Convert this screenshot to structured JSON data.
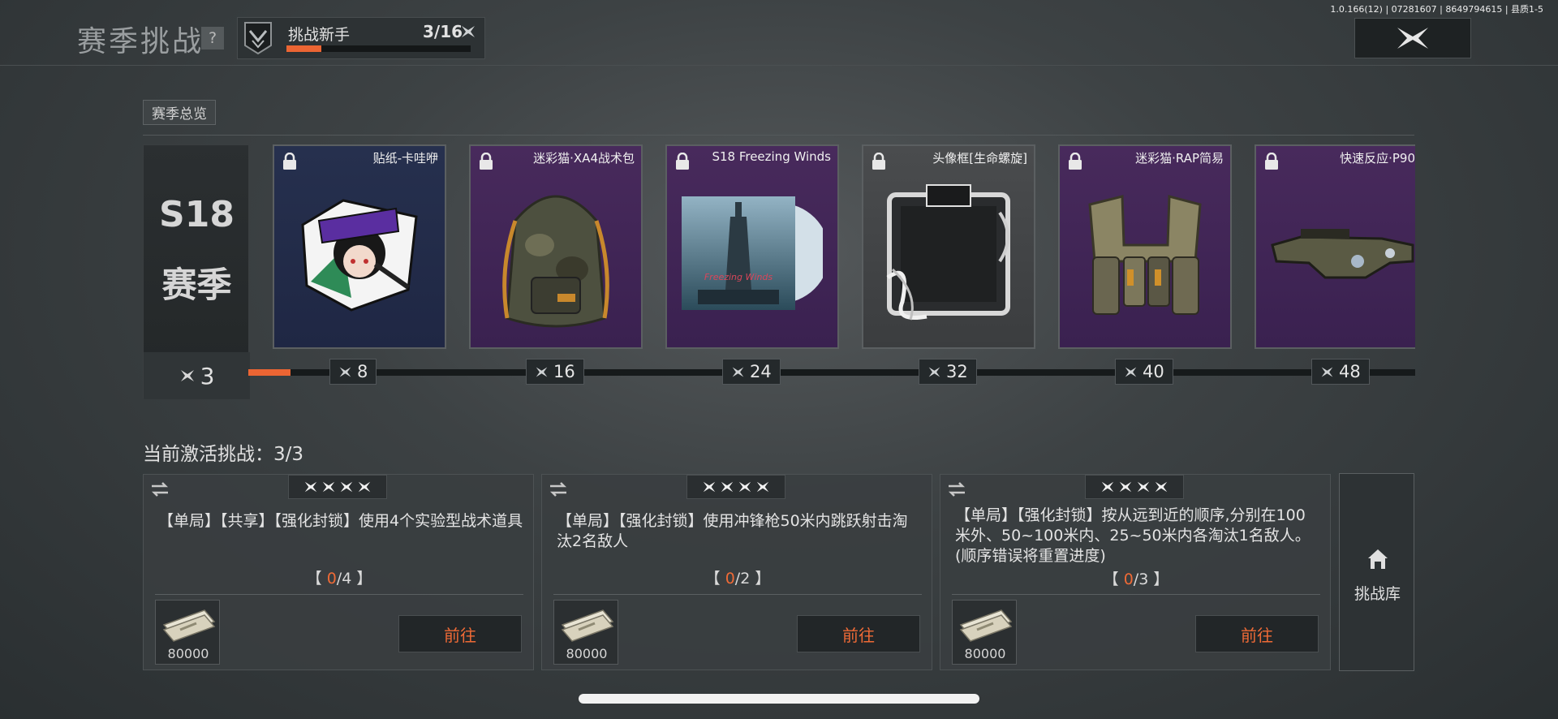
{
  "header": {
    "title": "赛季挑战",
    "help_label": "?",
    "rank_name": "挑战新手",
    "rank_progress_text": "3/16",
    "rank_progress_fraction": 0.1875,
    "version": "1.0.166(12) | 07281607 | 8649794615 | 县质1-5"
  },
  "overview": {
    "tag": "赛季总览",
    "season_line1": "S18",
    "season_line2": "赛季",
    "current_stars": "3",
    "track_fill_fraction": 0.02,
    "accent_color": "#ec6533",
    "rewards": [
      {
        "name": "贴纸-卡哇咿",
        "cost": "8",
        "rarity": "blue",
        "icon": "sticker-icon"
      },
      {
        "name": "迷彩猫·XA4战术包",
        "cost": "16",
        "rarity": "purple",
        "icon": "backpack-icon"
      },
      {
        "name": "S18 Freezing Winds",
        "cost": "24",
        "rarity": "purple",
        "icon": "album-icon"
      },
      {
        "name": "头像框[生命螺旋]",
        "cost": "32",
        "rarity": "gray",
        "icon": "avatar-frame-icon"
      },
      {
        "name": "迷彩猫·RAP简易",
        "cost": "40",
        "rarity": "purple",
        "icon": "vest-icon"
      },
      {
        "name": "快速反应·P90",
        "cost": "48",
        "rarity": "purple",
        "icon": "smg-icon"
      }
    ]
  },
  "challenges": {
    "header": "当前激活挑战：3/3",
    "items": [
      {
        "desc": "【单局】【共享】【强化封锁】使用4个实验型战术道具",
        "prog_open": "【 ",
        "done": "0",
        "total": "/4",
        "prog_close": " 】",
        "reward": "80000",
        "go": "前往"
      },
      {
        "desc": "【单局】【强化封锁】使用冲锋枪50米内跳跃射击淘汰2名敌人",
        "prog_open": "【 ",
        "done": "0",
        "total": "/2",
        "prog_close": " 】",
        "reward": "80000",
        "go": "前往"
      },
      {
        "desc": "【单局】【强化封锁】按从远到近的顺序,分别在100米外、50~100米内、25~50米内各淘汰1名敌人。(顺序错误将重置进度)",
        "prog_open": "【 ",
        "done": "0",
        "total": "/3",
        "prog_close": " 】",
        "reward": "80000",
        "go": "前往"
      }
    ],
    "library_label": "挑战库"
  }
}
